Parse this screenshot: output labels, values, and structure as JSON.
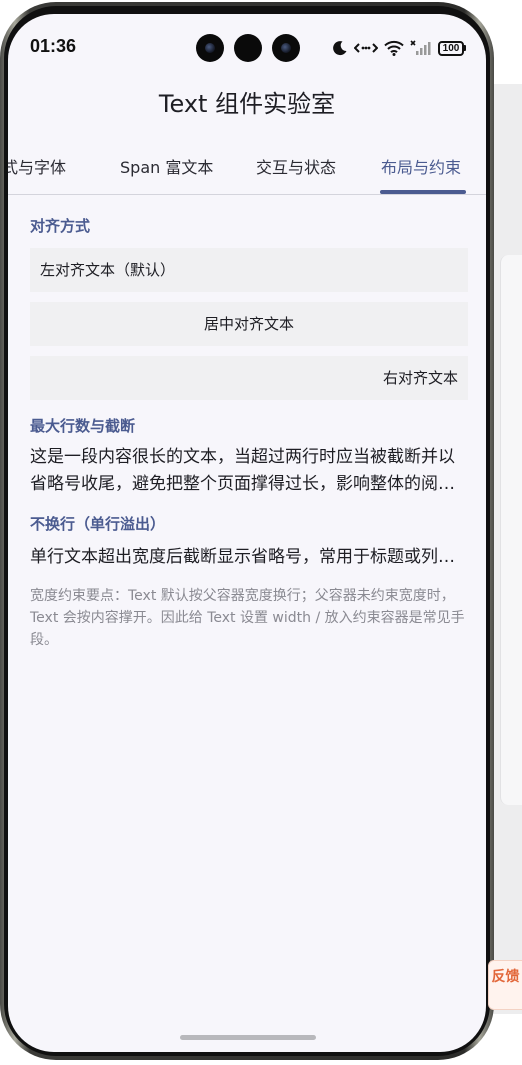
{
  "status_bar": {
    "time": "01:36",
    "battery": "100"
  },
  "header": {
    "title": "Text 组件实验室"
  },
  "tabs": [
    {
      "label": "式与字体"
    },
    {
      "label": "Span 富文本"
    },
    {
      "label": "交互与状态"
    },
    {
      "label": "布局与约束",
      "active": true
    }
  ],
  "sections": {
    "align": {
      "title": "对齐方式",
      "left": "左对齐文本（默认）",
      "center": "居中对齐文本",
      "right": "右对齐文本"
    },
    "maxlines": {
      "title": "最大行数与截断",
      "text": "这是一段内容很长的文本，当超过两行时应当被截断并以省略号收尾，避免把整个页面撑得过长，影响整体的阅读体验。"
    },
    "nowrap": {
      "title": "不换行（单行溢出）",
      "text": "单行文本超出宽度后截断显示省略号，常用于标题或列表项。"
    },
    "note": "宽度约束要点：Text 默认按父容器宽度换行；父容器未约束宽度时，Text 会按内容撑开。因此给 Text 设置 width / 放入约束容器是常见手段。"
  },
  "feedback": {
    "label": "反馈"
  },
  "colors": {
    "accent": "#4b5b90",
    "screen_bg": "#f7f6fb",
    "box_bg": "#f0f0f2",
    "feedback": "#e2673a"
  }
}
